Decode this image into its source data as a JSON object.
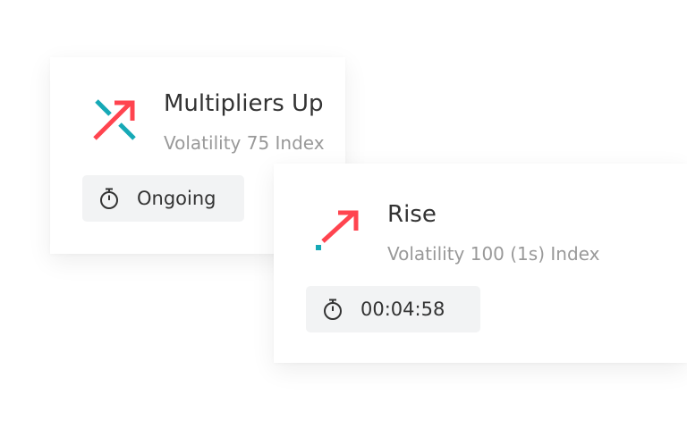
{
  "colors": {
    "accent_red": "#ff444f",
    "accent_teal": "#16a9b6",
    "badge_bg": "#f2f3f4"
  },
  "cards": [
    {
      "icon": "multipliers-up-icon",
      "title": "Multipliers Up",
      "market": "Volatility 75 Index",
      "badge": {
        "icon": "stopwatch-icon",
        "text": "Ongoing"
      }
    },
    {
      "icon": "rise-icon",
      "title": "Rise",
      "market": "Volatility 100 (1s) Index",
      "badge": {
        "icon": "stopwatch-icon",
        "text": "00:04:58"
      }
    }
  ]
}
